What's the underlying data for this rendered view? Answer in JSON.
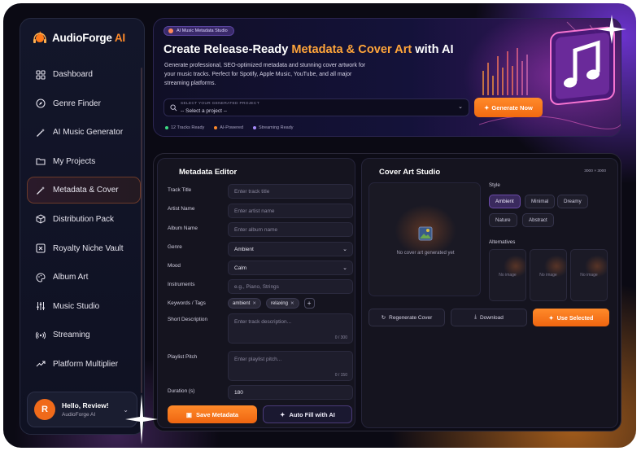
{
  "app": {
    "name": "AudioForge",
    "name_suffix": "AI"
  },
  "sidebar": {
    "items": [
      {
        "label": "Dashboard",
        "icon": "grid-icon"
      },
      {
        "label": "Genre Finder",
        "icon": "compass-icon"
      },
      {
        "label": "AI Music Generator",
        "icon": "magic-wand-icon"
      },
      {
        "label": "My Projects",
        "icon": "folder-icon"
      },
      {
        "label": "Metadata & Cover",
        "icon": "magic-wand-icon",
        "active": true
      },
      {
        "label": "Distribution Pack",
        "icon": "package-icon"
      },
      {
        "label": "Royalty Niche Vault",
        "icon": "vault-icon"
      },
      {
        "label": "Album Art",
        "icon": "palette-icon"
      },
      {
        "label": "Music Studio",
        "icon": "sliders-icon"
      },
      {
        "label": "Streaming",
        "icon": "broadcast-icon"
      },
      {
        "label": "Platform Multiplier",
        "icon": "trend-up-icon"
      }
    ],
    "user": {
      "initial": "R",
      "greeting": "Hello, Review!",
      "subtitle": "AudioForge AI"
    }
  },
  "hero": {
    "badge": "AI Music Metadata Studio",
    "title_prefix": "Create Release-Ready ",
    "title_highlight": "Metadata & Cover Art",
    "title_suffix": " with AI",
    "description": "Generate professional, SEO-optimized metadata and stunning cover artwork for your music tracks. Perfect for Spotify, Apple Music, YouTube, and all major streaming platforms.",
    "select_label": "SELECT YOUR GENERATED PROJECT",
    "select_value": "-- Select a project --",
    "generate_button": "Generate Now",
    "stats": [
      {
        "text": "12 Tracks Ready",
        "color": "#3ddc84"
      },
      {
        "text": "AI-Powered",
        "color": "#ff8a2a"
      },
      {
        "text": "Streaming Ready",
        "color": "#a78bfa"
      }
    ]
  },
  "metadata_editor": {
    "title": "Metadata Editor",
    "fields": {
      "track_title": {
        "label": "Track Title",
        "placeholder": "Enter track title"
      },
      "artist_name": {
        "label": "Artist Name",
        "placeholder": "Enter artist name"
      },
      "album_name": {
        "label": "Album Name",
        "placeholder": "Enter album name"
      },
      "genre": {
        "label": "Genre",
        "value": "Ambient"
      },
      "mood": {
        "label": "Mood",
        "value": "Calm"
      },
      "instruments": {
        "label": "Instruments",
        "placeholder": "e.g., Piano, Strings"
      },
      "keywords": {
        "label": "Keywords / Tags",
        "tags": [
          "ambient",
          "relaxing"
        ]
      },
      "short_description": {
        "label": "Short Description",
        "placeholder": "Enter track description...",
        "count": "0 / 300"
      },
      "playlist_pitch": {
        "label": "Playlist Pitch",
        "placeholder": "Enter playlist pitch...",
        "count": "0 / 150"
      },
      "duration": {
        "label": "Duration (s)",
        "value": "180"
      }
    },
    "save_button": "Save Metadata",
    "autofill_button": "Auto Fill with AI"
  },
  "cover_studio": {
    "title": "Cover Art Studio",
    "dimensions": "3000 × 3000",
    "empty_text": "No cover art generated yet",
    "style_label": "Style",
    "styles": [
      "Ambient",
      "Minimal",
      "Dreamy",
      "Nature",
      "Abstract"
    ],
    "active_style": "Ambient",
    "alternatives_label": "Alternatives",
    "alternatives": [
      "No image",
      "No image",
      "No image"
    ],
    "regenerate_button": "Regenerate Cover",
    "download_button": "Download",
    "use_button": "Use Selected"
  }
}
